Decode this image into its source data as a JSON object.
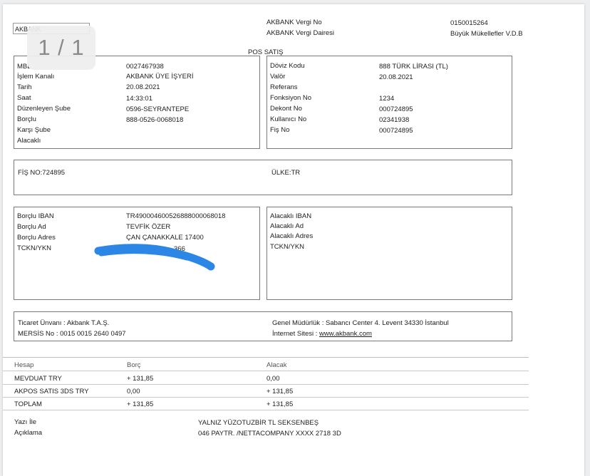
{
  "header": {
    "bank_logo_text": "AKBANK",
    "tax_no_label": "AKBANK Vergi No",
    "tax_no_value": "0150015264",
    "tax_office_label": "AKBANK Vergi Dairesi",
    "tax_office_value": "Büyük Mükellefler V.D.B",
    "title": "POS SATIŞ"
  },
  "viewer": {
    "page_indicator": "1 / 1"
  },
  "left_info": {
    "rows": [
      {
        "label": "MBL",
        "value": "0027467938"
      },
      {
        "label": "İşlem Kanalı",
        "value": "AKBANK ÜYE İŞYERİ"
      },
      {
        "label": "Tarih",
        "value": "20.08.2021"
      },
      {
        "label": "Saat",
        "value": "14:33:01"
      },
      {
        "label": "Düzenleyen Şube",
        "value": "0596-SEYRANTEPE"
      },
      {
        "label": "Borçlu",
        "value": "888-0526-0068018"
      },
      {
        "label": "Karşı Şube",
        "value": ""
      },
      {
        "label": "Alacaklı",
        "value": ""
      }
    ]
  },
  "right_info": {
    "rows": [
      {
        "label": "Döviz Kodu",
        "value": "888 TÜRK LİRASI (TL)"
      },
      {
        "label": "Valör",
        "value": "20.08.2021"
      },
      {
        "label": "Referans",
        "value": ""
      },
      {
        "label": "Fonksiyon No",
        "value": "1234"
      },
      {
        "label": "Dekont No",
        "value": "000724895"
      },
      {
        "label": "Kullanıcı No",
        "value": "02341938"
      },
      {
        "label": "Fiş No",
        "value": "000724895"
      }
    ]
  },
  "fis": {
    "fis_no": "FİŞ NO:724895",
    "country": "ÜLKE:TR"
  },
  "debtor": {
    "rows": [
      {
        "label": "Borçlu IBAN",
        "value": "TR490004600526888000068018"
      },
      {
        "label": "Borçlu Ad",
        "value": "TEVFİK ÖZER"
      },
      {
        "label": "Borçlu Adres",
        "value": "ÇAN ÇANAKKALE 17400"
      },
      {
        "label": "TCKN/YKN",
        "value": "366"
      }
    ]
  },
  "creditor": {
    "rows": [
      {
        "label": "Alacaklı IBAN"
      },
      {
        "label": "Alacaklı Ad"
      },
      {
        "label": "Alacaklı Adres"
      },
      {
        "label": "TCKN/YKN"
      }
    ]
  },
  "company": {
    "trade_name": "Ticaret Ünvanı : Akbank T.A.Ş.",
    "mersis": "MERSİS No : 0015 0015 2640 0497",
    "hq": "Genel Müdürlük : Sabancı Center 4. Levent 34330 İstanbul",
    "website_label": "İnternet Sitesi : ",
    "website_url": "www.akbank.com"
  },
  "ledger": {
    "headers": {
      "account": "Hesap",
      "debit": "Borç",
      "credit": "Alacak"
    },
    "rows": [
      {
        "account": "MEVDUAT TRY",
        "debit": "+ 131,85",
        "credit": "0,00"
      },
      {
        "account": "AKPOS SATIS 3DS TRY",
        "debit": "0,00",
        "credit": "+ 131,85"
      },
      {
        "account": "TOPLAM",
        "debit": "+ 131,85",
        "credit": "+ 131,85"
      }
    ]
  },
  "footer": {
    "written_label": "Yazı İle",
    "written_value": "YALNIZ YÜZOTUZBİR TL SEKSENBEŞ",
    "desc_label": "Açıklama",
    "desc_value": "046 PAYTR. /NETTACOMPANY XXXX 2718 3D"
  },
  "colors": {
    "redaction": "#2b86e6",
    "border": "#7a7a7a"
  }
}
